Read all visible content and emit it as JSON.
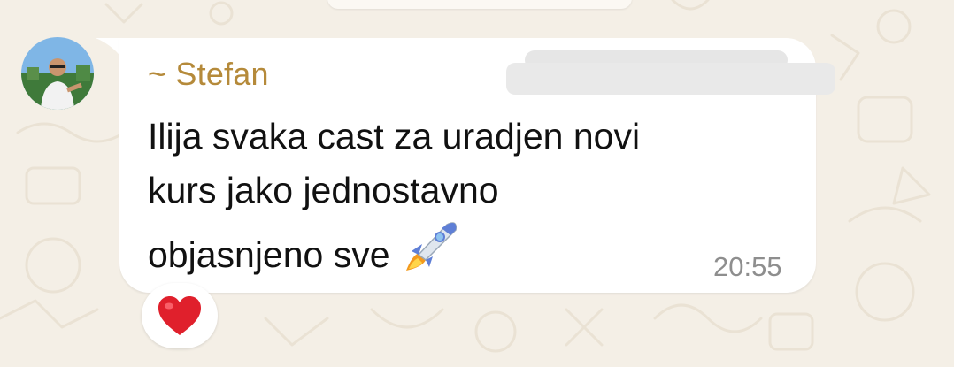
{
  "chat": {
    "message": {
      "sender": "~ Stefan",
      "lines": [
        "Ilija svaka cast za uradjen novi",
        "kurs jako jednostavno",
        "objasnjeno sve"
      ],
      "emoji": "rocket-icon",
      "time": "20:55",
      "reaction": "heart-icon"
    }
  },
  "colors": {
    "background": "#f4efe6",
    "bubble": "#ffffff",
    "sender": "#b58a3a",
    "time": "#8e8e8e",
    "heart": "#e0202c"
  }
}
